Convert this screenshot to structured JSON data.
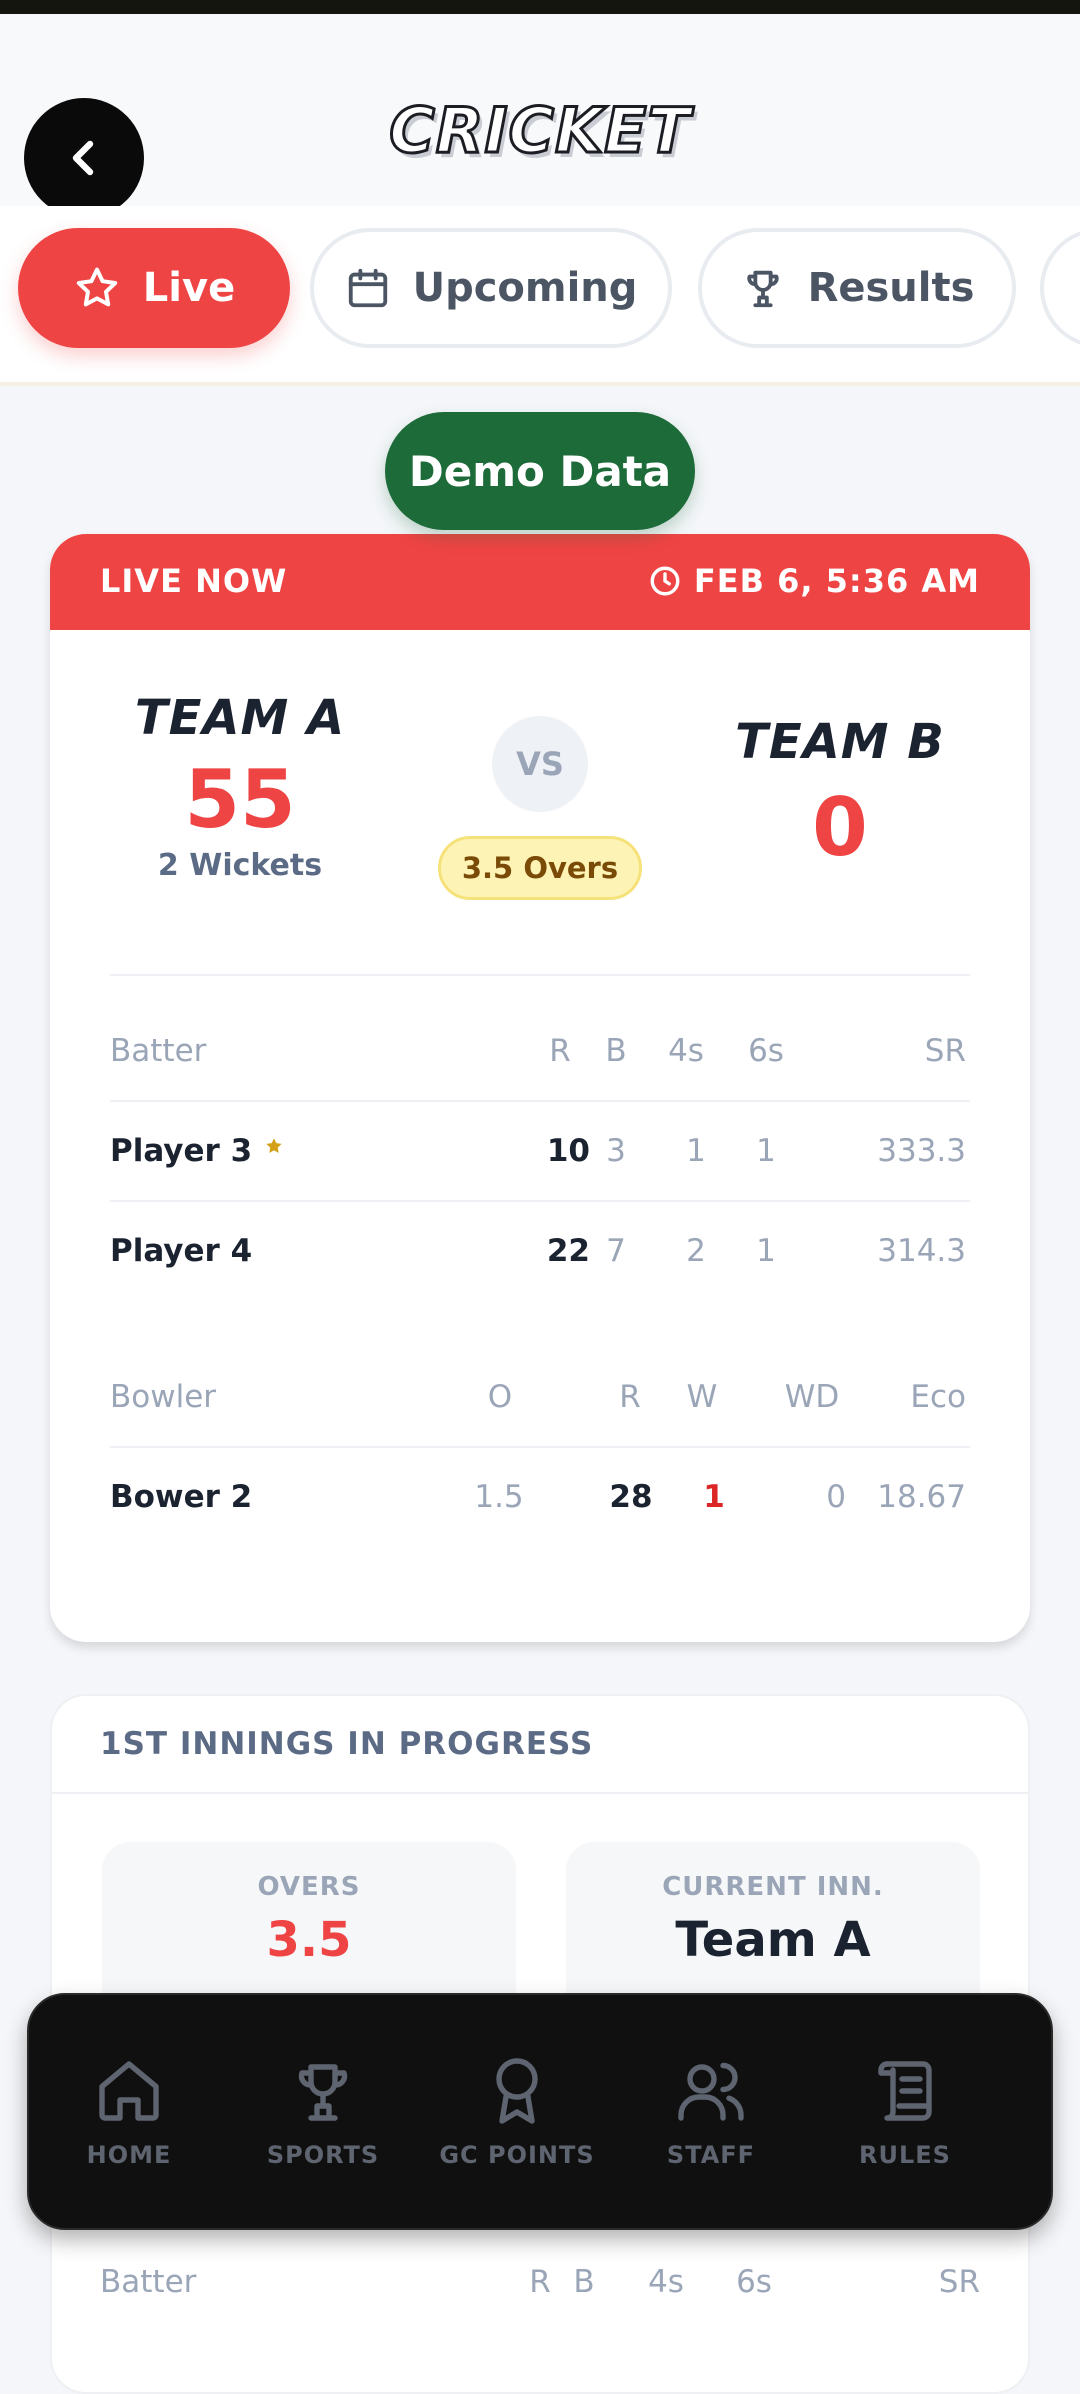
{
  "header": {
    "title": "CRICKET"
  },
  "tabs": [
    {
      "label": "Live",
      "icon": "star-icon",
      "active": true
    },
    {
      "label": "Upcoming",
      "icon": "calendar-icon",
      "active": false
    },
    {
      "label": "Results",
      "icon": "trophy-icon",
      "active": false
    }
  ],
  "demo_badge": "Demo Data",
  "live_match": {
    "status": "LIVE NOW",
    "time": "FEB 6, 5:36 AM",
    "team_a": {
      "name": "TEAM A",
      "score": "55",
      "wickets": "2 Wickets"
    },
    "vs": "VS",
    "overs": "3.5 Overs",
    "team_b": {
      "name": "TEAM B",
      "score": "0"
    },
    "batting": {
      "headers": [
        "Batter",
        "R",
        "B",
        "4s",
        "6s",
        "SR"
      ],
      "rows": [
        {
          "name": "Player 3",
          "on_strike": true,
          "r": "10",
          "b": "3",
          "fours": "1",
          "sixes": "1",
          "sr": "333.3"
        },
        {
          "name": "Player 4",
          "on_strike": false,
          "r": "22",
          "b": "7",
          "fours": "2",
          "sixes": "1",
          "sr": "314.3"
        }
      ]
    },
    "bowling": {
      "headers": [
        "Bowler",
        "O",
        "R",
        "W",
        "WD",
        "Eco"
      ],
      "rows": [
        {
          "name": "Bower 2",
          "o": "1.5",
          "r": "28",
          "w": "1",
          "wd": "0",
          "eco": "18.67"
        }
      ]
    }
  },
  "innings": {
    "title": "1ST INNINGS IN PROGRESS",
    "overs_label": "OVERS",
    "overs_value": "3.5",
    "current_label": "CURRENT INN.",
    "current_value": "Team A",
    "batting_headers": [
      "Batter",
      "R",
      "B",
      "4s",
      "6s",
      "SR"
    ]
  },
  "nav": [
    {
      "label": "HOME",
      "icon": "home-icon"
    },
    {
      "label": "SPORTS",
      "icon": "trophy-icon"
    },
    {
      "label": "GC POINTS",
      "icon": "award-icon"
    },
    {
      "label": "STAFF",
      "icon": "users-icon"
    },
    {
      "label": "RULES",
      "icon": "scroll-icon"
    }
  ],
  "colors": {
    "accent": "#ef4444",
    "demo": "#1e6b3a",
    "nav_bg": "#101010",
    "overs_pill": "#fdf3b4",
    "star": "#d4a017"
  }
}
